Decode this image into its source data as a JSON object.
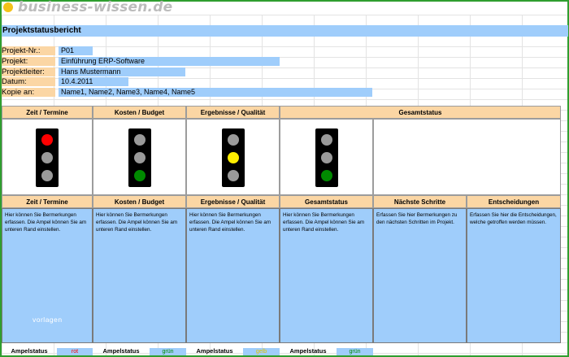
{
  "brand": {
    "text": "business-wissen.de",
    "logo_icon": "sun-logo-icon"
  },
  "report": {
    "title": "Projektstatusbericht"
  },
  "meta": {
    "project_no_label": "Projekt-Nr.:",
    "project_no_value": "P01",
    "project_label": "Projekt:",
    "project_value": "Einführung ERP-Software",
    "lead_label": "Projektleiter:",
    "lead_value": "Hans Mustermann",
    "date_label": "Datum:",
    "date_value": "10.4.2011",
    "copy_label": "Kopie an:",
    "copy_value": "Name1, Name2, Name3, Name4, Name5"
  },
  "top_headers": {
    "time": "Zeit / Termine",
    "cost": "Kosten / Budget",
    "results": "Ergebnisse / Qualität",
    "overall": "Gesamtstatus"
  },
  "traffic_lights": [
    {
      "name": "time",
      "active": "red"
    },
    {
      "name": "cost",
      "active": "green"
    },
    {
      "name": "results",
      "active": "yellow"
    },
    {
      "name": "overall",
      "active": "green"
    }
  ],
  "colors": {
    "red": "#ff0000",
    "yellow": "#ffee00",
    "green": "#008a00",
    "off": "#9a9a9a",
    "header_bg": "#fbd6a4",
    "field_bg": "#9fcdfb"
  },
  "bottom_headers": {
    "time": "Zeit / Termine",
    "cost": "Kosten / Budget",
    "results": "Ergebnisse / Qualität",
    "overall": "Gesamtstatus",
    "next": "Nächste Schritte",
    "decisions": "Entscheidungen"
  },
  "comments": {
    "time": "Hier können Sie Bermerkungen erfassen. Die Ampel können Sie am unteren Rand einstellen.",
    "cost": "Hier können Sie Bermerkungen erfassen. Die Ampel können Sie am unteren Rand einstellen.",
    "results": "Hier können Sie Bermerkungen erfassen. Die Ampel können Sie am unteren Rand einstellen.",
    "overall": "Hier können Sie Bermerkungen erfassen. Die Ampel können Sie am unteren Rand einstellen.",
    "next": "Erfassen Sie hier Bermerkungen zu den nächsten Schritten im Projekt.",
    "decisions": "Erfassen Sie hier die Entscheidungen, welche getroffen werden müssen."
  },
  "watermark": "vorlagen",
  "status_row": {
    "label": "Ampelstatus",
    "time_value": "rot",
    "cost_value": "grün",
    "results_value": "gelb",
    "overall_value": "grün"
  }
}
